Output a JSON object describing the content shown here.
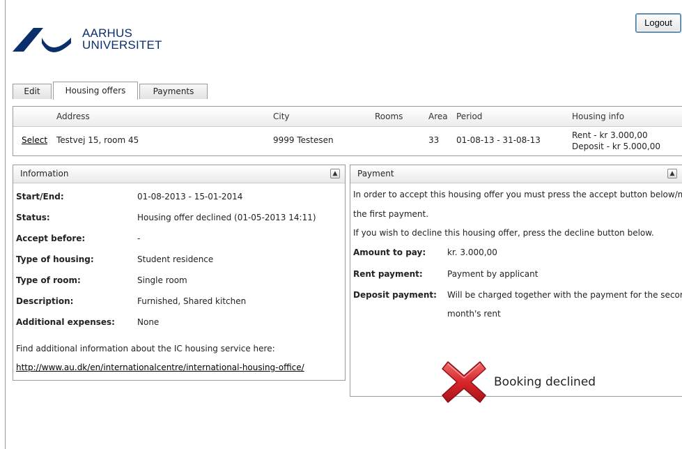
{
  "header": {
    "logo_line1": "AARHUS",
    "logo_line2": "UNIVERSITET",
    "logout_label": "Logout"
  },
  "tabs": [
    {
      "label": "Edit",
      "active": false
    },
    {
      "label": "Housing offers",
      "active": true
    },
    {
      "label": "Payments",
      "active": false
    }
  ],
  "offers": {
    "columns": [
      "Address",
      "City",
      "Rooms",
      "Area",
      "Period",
      "Housing info"
    ],
    "rows": [
      {
        "action": "Select",
        "address": "Testvej 15, room 45",
        "city": "9999 Testesen",
        "rooms": "",
        "area": "33",
        "period": "01-08-13 - 31-08-13",
        "housing_info": "Rent - kr 3.000,00 Deposit - kr 5.000,00"
      }
    ]
  },
  "information": {
    "title": "Information",
    "fields": [
      {
        "label": "Start/End:",
        "value": "01-08-2013 - 15-01-2014"
      },
      {
        "label": "Status:",
        "value": "Housing offer declined (01-05-2013 14:11)"
      },
      {
        "label": "Accept before:",
        "value": "-"
      },
      {
        "label": "Type of housing:",
        "value": "Student residence"
      },
      {
        "label": "Type of room:",
        "value": "Single room"
      },
      {
        "label": "Description:",
        "value": "Furnished, Shared kitchen"
      },
      {
        "label": "Additional expenses:",
        "value": "None"
      }
    ],
    "find_text": "Find additional information about the IC housing service here:",
    "link_text": "http://www.au.dk/en/internationalcentre/international-housing-office/"
  },
  "payment": {
    "title": "Payment",
    "intro_line1": "In order to accept this housing offer you must press the accept button below/make",
    "intro_line2": "the first payment.",
    "intro_line3": "If you wish to decline this housing offer, press the decline button below.",
    "amount_label": "Amount to pay:",
    "amount_value": "kr. 3.000,00",
    "rent_label": "Rent payment:",
    "rent_value": "Payment by applicant",
    "deposit_label": "Deposit payment:",
    "deposit_value_line1": "Will be charged together with the payment for the second",
    "deposit_value_line2": "month's rent",
    "declined_text": "Booking declined"
  },
  "colors": {
    "brand": "#0b2f6b",
    "declined_x": "#d8262b"
  }
}
